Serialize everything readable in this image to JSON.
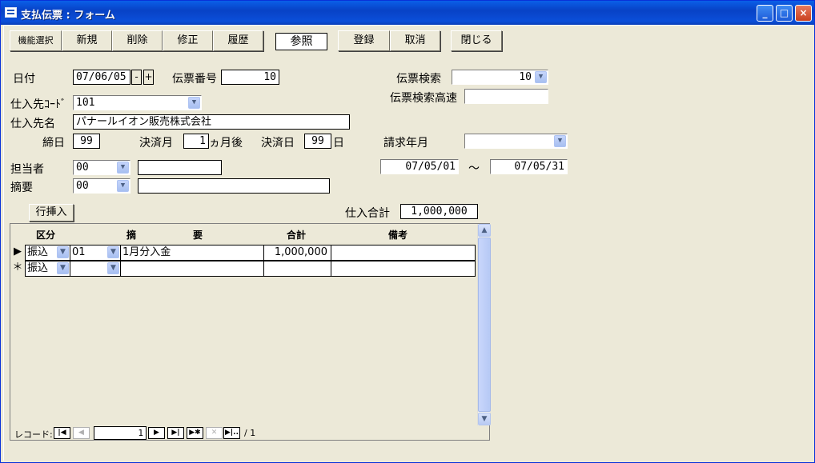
{
  "window": {
    "title": "支払伝票 : フォーム",
    "controls": {
      "minimize": "_",
      "maximize": "□",
      "close": "×"
    }
  },
  "toolbar": {
    "func_select": "機能選択",
    "new": "新規",
    "delete": "削除",
    "edit": "修正",
    "history": "履歴",
    "reference": "参照",
    "register": "登録",
    "cancel": "取消",
    "close": "閉じる"
  },
  "form": {
    "date_label": "日付",
    "date_value": "07/06/05",
    "date_minus": "-",
    "date_plus": "+",
    "slip_no_label": "伝票番号",
    "slip_no_value": "10",
    "slip_search_label": "伝票検索",
    "slip_search_value": "10",
    "slip_fast_search_label": "伝票検索高速",
    "slip_fast_search_value": "",
    "supplier_code_label": "仕入先ｺｰﾄﾞ",
    "supplier_code_value": "101",
    "supplier_name_label": "仕入先名",
    "supplier_name_value": "パナールイオン販売株式会社",
    "closing_day_label": "締日",
    "closing_day_value": "99",
    "settle_month_label": "決済月",
    "settle_month_value": "1",
    "settle_month_suffix": "ヵ月後",
    "settle_day_label": "決済日",
    "settle_day_value": "99",
    "settle_day_suffix": "日",
    "billing_month_label": "請求年月",
    "billing_month_value": "",
    "staff_label": "担当者",
    "staff_code": "00",
    "staff_name": "",
    "period_from": "07/05/01",
    "period_sep": "～",
    "period_to": "07/05/31",
    "summary_label": "摘要",
    "summary_code": "00",
    "summary_text": "",
    "insert_row_button": "行挿入",
    "total_label": "仕入合計",
    "total_value": "1,000,000"
  },
  "grid": {
    "headers": {
      "kubun": "区分",
      "summary_1": "摘",
      "summary_2": "要",
      "total": "合計",
      "note": "備考"
    },
    "rows": [
      {
        "selector": "▶",
        "kubun": "振込",
        "code": "01",
        "summary": "1月分入金",
        "total": "1,000,000",
        "note": ""
      },
      {
        "selector": "＊",
        "kubun": "振込",
        "code": "",
        "summary": "",
        "total": "",
        "note": ""
      }
    ],
    "nav": {
      "label": "レコード:",
      "current": "1",
      "of": "/ 1",
      "first": "|◀",
      "prev": "◀",
      "next": "▶",
      "last": "▶|",
      "new": "▶✱",
      "delete": "✕",
      "jump": "▶|.."
    }
  }
}
